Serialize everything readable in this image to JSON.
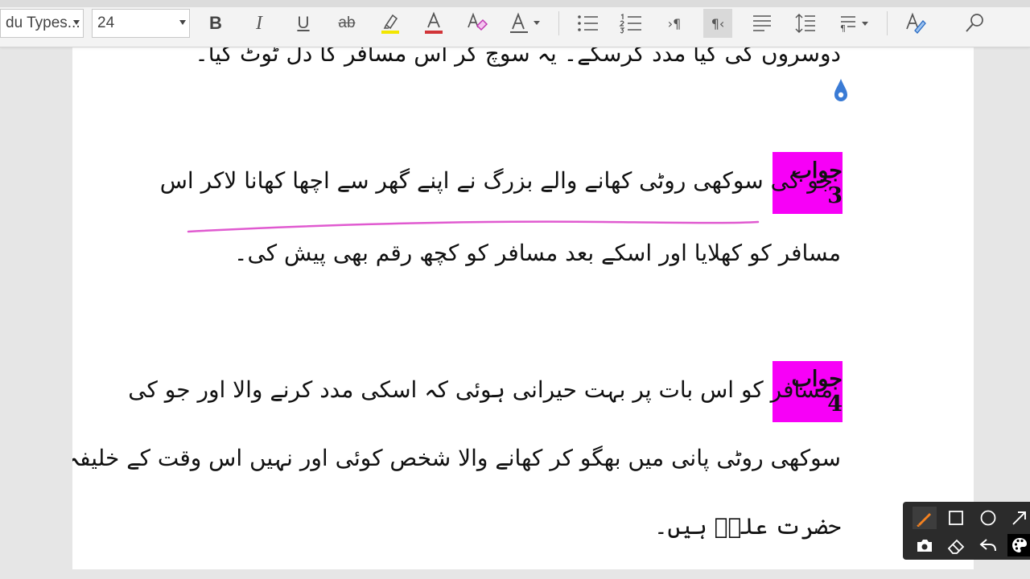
{
  "toolbar": {
    "font_name": "du Types...",
    "font_size": "24",
    "bold_label": "B",
    "italic_label": "I",
    "underline_label": "U",
    "strikethrough_label": "ab",
    "ltr_label": "›¶",
    "rtl_label": "¶‹",
    "icons": [
      "bold-icon",
      "italic-icon",
      "underline-icon",
      "strikethrough-icon",
      "highlight-icon",
      "font-color-icon",
      "clear-format-icon",
      "text-effects-icon",
      "bullets-icon",
      "numbering-icon",
      "ltr-icon",
      "rtl-icon",
      "align-icon",
      "line-spacing-icon",
      "paragraph-icon",
      "styles-icon",
      "search-icon"
    ],
    "colors": {
      "highlight": "#f2e600",
      "font_color": "#d13438",
      "clear_format": "#c239b3"
    }
  },
  "document": {
    "line_top": "دوسروں کی کیا مدد کرسکے۔ یہ سوچ کر اس مسافر کا دل ٹوٹ گیا۔",
    "answer3": {
      "label": "جواب 3",
      "line1": "جو کی سوکھی روٹی کھانے والے بزرگ نے اپنے گھر سے اچھا کھانا لاکر اس",
      "line2": "مسافر کو کھلایا اور اسکے بعد مسافر کو کچھ رقم بھی پیش کی۔"
    },
    "answer4": {
      "label": "جواب 4",
      "line1": "مسافر کو اس بات پر بہت حیرانی ہوئی کہ اسکی مدد کرنے والا اور جو کی",
      "line2": "سوکھی روٹی پانی میں بھگو کر کھانے والا شخص کوئی اور نہیں اس وقت کے خلیفہ",
      "line3": "حضرت علیؓ ہیں۔"
    },
    "colors": {
      "label_bg": "#f700f7",
      "underline_ink": "#e05ad0",
      "drop": "#3a7bd5"
    }
  },
  "ink_tools": {
    "items": [
      "pen-icon",
      "rectangle-icon",
      "circle-icon",
      "arrow-icon",
      "camera-icon",
      "eraser-icon",
      "undo-icon",
      "palette-icon"
    ],
    "colors": {
      "pen": "#f58220",
      "background": "#2b2b2b"
    }
  }
}
